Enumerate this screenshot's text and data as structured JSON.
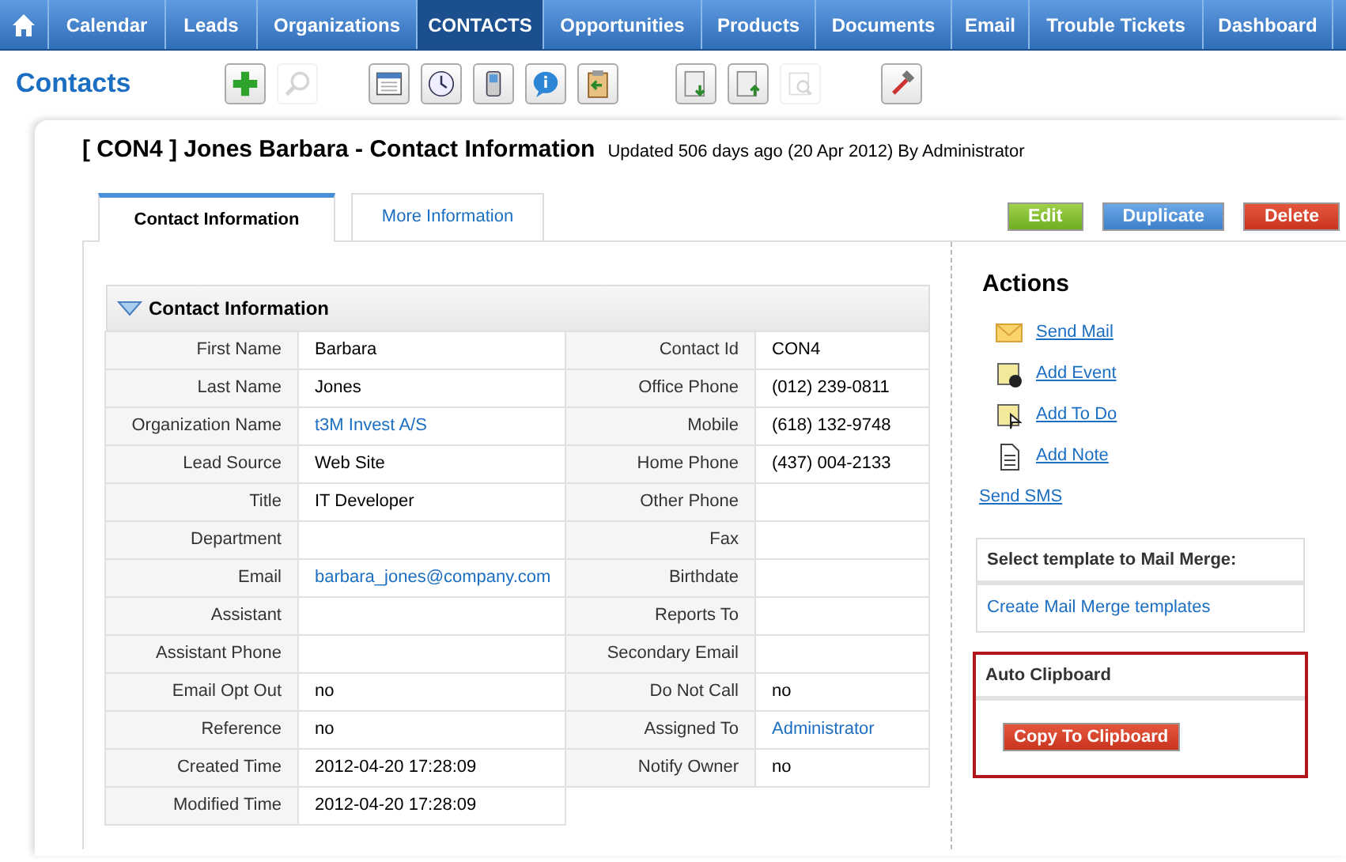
{
  "nav": {
    "tabs": [
      {
        "kind": "home",
        "selected": false
      },
      {
        "label": "Calendar",
        "selected": false
      },
      {
        "label": "Leads",
        "selected": false
      },
      {
        "label": "Organizations",
        "selected": false
      },
      {
        "label": "CONTACTS",
        "selected": true
      },
      {
        "label": "Opportunities",
        "selected": false
      },
      {
        "label": "Products",
        "selected": false
      },
      {
        "label": "Documents",
        "selected": false
      },
      {
        "label": "Email",
        "selected": false
      },
      {
        "label": "Trouble Tickets",
        "selected": false
      },
      {
        "label": "Dashboard",
        "selected": false
      }
    ]
  },
  "module_title": "Contacts",
  "toolbar": [
    [
      {
        "kind": "plus",
        "disabled": false
      },
      {
        "kind": "search",
        "disabled": true
      }
    ],
    [
      {
        "kind": "calendar",
        "disabled": false
      },
      {
        "kind": "clock",
        "disabled": false
      },
      {
        "kind": "phone",
        "disabled": false
      },
      {
        "kind": "info",
        "disabled": false
      },
      {
        "kind": "clipboard",
        "disabled": false
      }
    ],
    [
      {
        "kind": "import",
        "disabled": false
      },
      {
        "kind": "export",
        "disabled": false
      },
      {
        "kind": "find",
        "disabled": true
      }
    ],
    [
      {
        "kind": "tools",
        "disabled": false
      }
    ]
  ],
  "record": {
    "title": "[ CON4 ] Jones Barbara - Contact Information",
    "updated": "Updated 506 days ago (20 Apr 2012) By Administrator"
  },
  "tabs": [
    {
      "label": "Contact Information",
      "selected": true
    },
    {
      "label": "More Information",
      "selected": false
    }
  ],
  "buttons": [
    {
      "label": "Edit",
      "kind": "edit"
    },
    {
      "label": "Duplicate",
      "kind": "duplicate"
    },
    {
      "label": "Delete",
      "kind": "delete"
    }
  ],
  "section": {
    "title": "Contact Information",
    "expanded": true
  },
  "rows": [
    {
      "left": {
        "label": "First Name",
        "value": "Barbara"
      },
      "right": {
        "label": "Contact Id",
        "value": "CON4"
      }
    },
    {
      "left": {
        "label": "Last Name",
        "value": "Jones"
      },
      "right": {
        "label": "Office Phone",
        "value": "(012) 239-0811"
      }
    },
    {
      "left": {
        "label": "Organization Name",
        "value": "t3M Invest A/S",
        "link": true
      },
      "right": {
        "label": "Mobile",
        "value": "(618) 132-9748"
      }
    },
    {
      "left": {
        "label": "Lead Source",
        "value": "Web Site"
      },
      "right": {
        "label": "Home Phone",
        "value": "(437) 004-2133"
      }
    },
    {
      "left": {
        "label": "Title",
        "value": "IT Developer"
      },
      "right": {
        "label": "Other Phone"
      }
    },
    {
      "left": {
        "label": "Department"
      },
      "right": {
        "label": "Fax"
      }
    },
    {
      "left": {
        "label": "Email",
        "value": "barbara_jones@company.com",
        "link": true
      },
      "right": {
        "label": "Birthdate"
      }
    },
    {
      "left": {
        "label": "Assistant"
      },
      "right": {
        "label": "Reports To"
      }
    },
    {
      "left": {
        "label": "Assistant Phone"
      },
      "right": {
        "label": "Secondary Email"
      }
    },
    {
      "left": {
        "label": "Email Opt Out",
        "value": "no"
      },
      "right": {
        "label": "Do Not Call",
        "value": "no"
      }
    },
    {
      "left": {
        "label": "Reference",
        "value": "no"
      },
      "right": {
        "label": "Assigned To",
        "value": "Administrator",
        "link": true
      }
    },
    {
      "left": {
        "label": "Created Time",
        "value": "2012-04-20 17:28:09"
      },
      "right": {
        "label": "Notify Owner",
        "value": "no"
      }
    },
    {
      "left": {
        "label": "Modified Time",
        "value": "2012-04-20 17:28:09"
      }
    }
  ],
  "actions": {
    "title": "Actions",
    "items": [
      {
        "label": "Send Mail",
        "kind": "mail"
      },
      {
        "label": "Add Event",
        "kind": "event"
      },
      {
        "label": "Add To Do",
        "kind": "todo"
      },
      {
        "label": "Add Note",
        "kind": "note"
      },
      {
        "label": "Send SMS",
        "kind": "none"
      }
    ]
  },
  "mail_merge": {
    "title": "Select template to Mail Merge:",
    "link": "Create Mail Merge templates"
  },
  "clipboard": {
    "title": "Auto Clipboard",
    "button": "Copy To Clipboard"
  }
}
